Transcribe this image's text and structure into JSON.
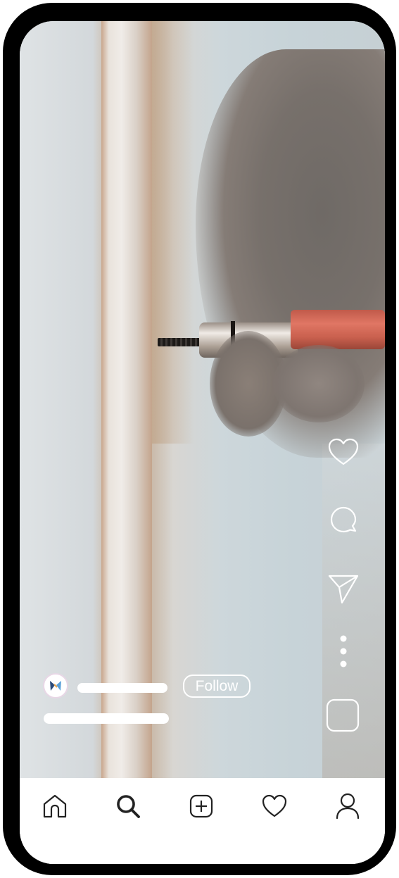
{
  "reel": {
    "follow_label": "Follow",
    "media": "photo-hand-screwdriver-drywall"
  },
  "actions": [
    {
      "name": "like-button",
      "icon": "heart-icon"
    },
    {
      "name": "comment-button",
      "icon": "comment-icon"
    },
    {
      "name": "share-button",
      "icon": "send-icon"
    },
    {
      "name": "more-button",
      "icon": "more-vertical-icon"
    },
    {
      "name": "audio-button",
      "icon": "audio-thumbnail-icon"
    }
  ],
  "nav": [
    {
      "name": "nav-home",
      "icon": "home-icon"
    },
    {
      "name": "nav-search",
      "icon": "search-icon"
    },
    {
      "name": "nav-create",
      "icon": "plus-square-icon"
    },
    {
      "name": "nav-activity",
      "icon": "heart-icon"
    },
    {
      "name": "nav-profile",
      "icon": "profile-icon"
    }
  ],
  "colors": {
    "frame": "#000000",
    "overlay": "#ffffff",
    "navbar_bg": "#ffffff",
    "icon_dark": "#222222"
  }
}
